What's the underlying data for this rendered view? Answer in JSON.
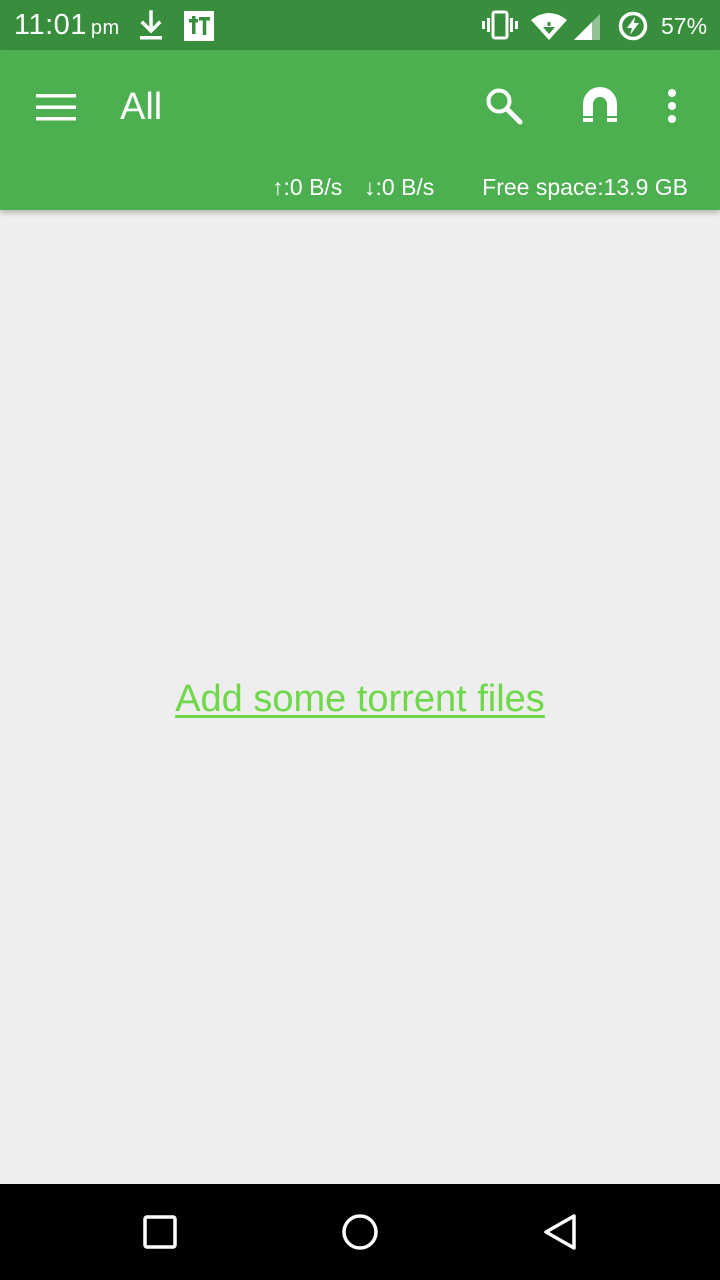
{
  "status_bar": {
    "time": "11:01",
    "ampm": "pm",
    "battery": "57%",
    "icons": [
      "download-icon",
      "tt-app-icon",
      "vibrate-icon",
      "wifi-icon",
      "cell-signal-icon",
      "battery-saver-icon"
    ]
  },
  "app_bar": {
    "title": "All",
    "upload_speed": "↑:0 B/s",
    "download_speed": "↓:0 B/s",
    "free_space": "Free space:13.9 GB",
    "actions": [
      "menu-icon",
      "search-icon",
      "magnet-icon",
      "more-vert-icon"
    ]
  },
  "content": {
    "empty_link": "Add some torrent files"
  },
  "nav_bar": {
    "buttons": [
      "recents-button",
      "home-button",
      "back-button"
    ]
  },
  "colors": {
    "status_bar": "#388e3c",
    "app_bar": "#4caf50",
    "background": "#eeeeee",
    "link": "#6ed84a",
    "nav_bar": "#000000"
  }
}
